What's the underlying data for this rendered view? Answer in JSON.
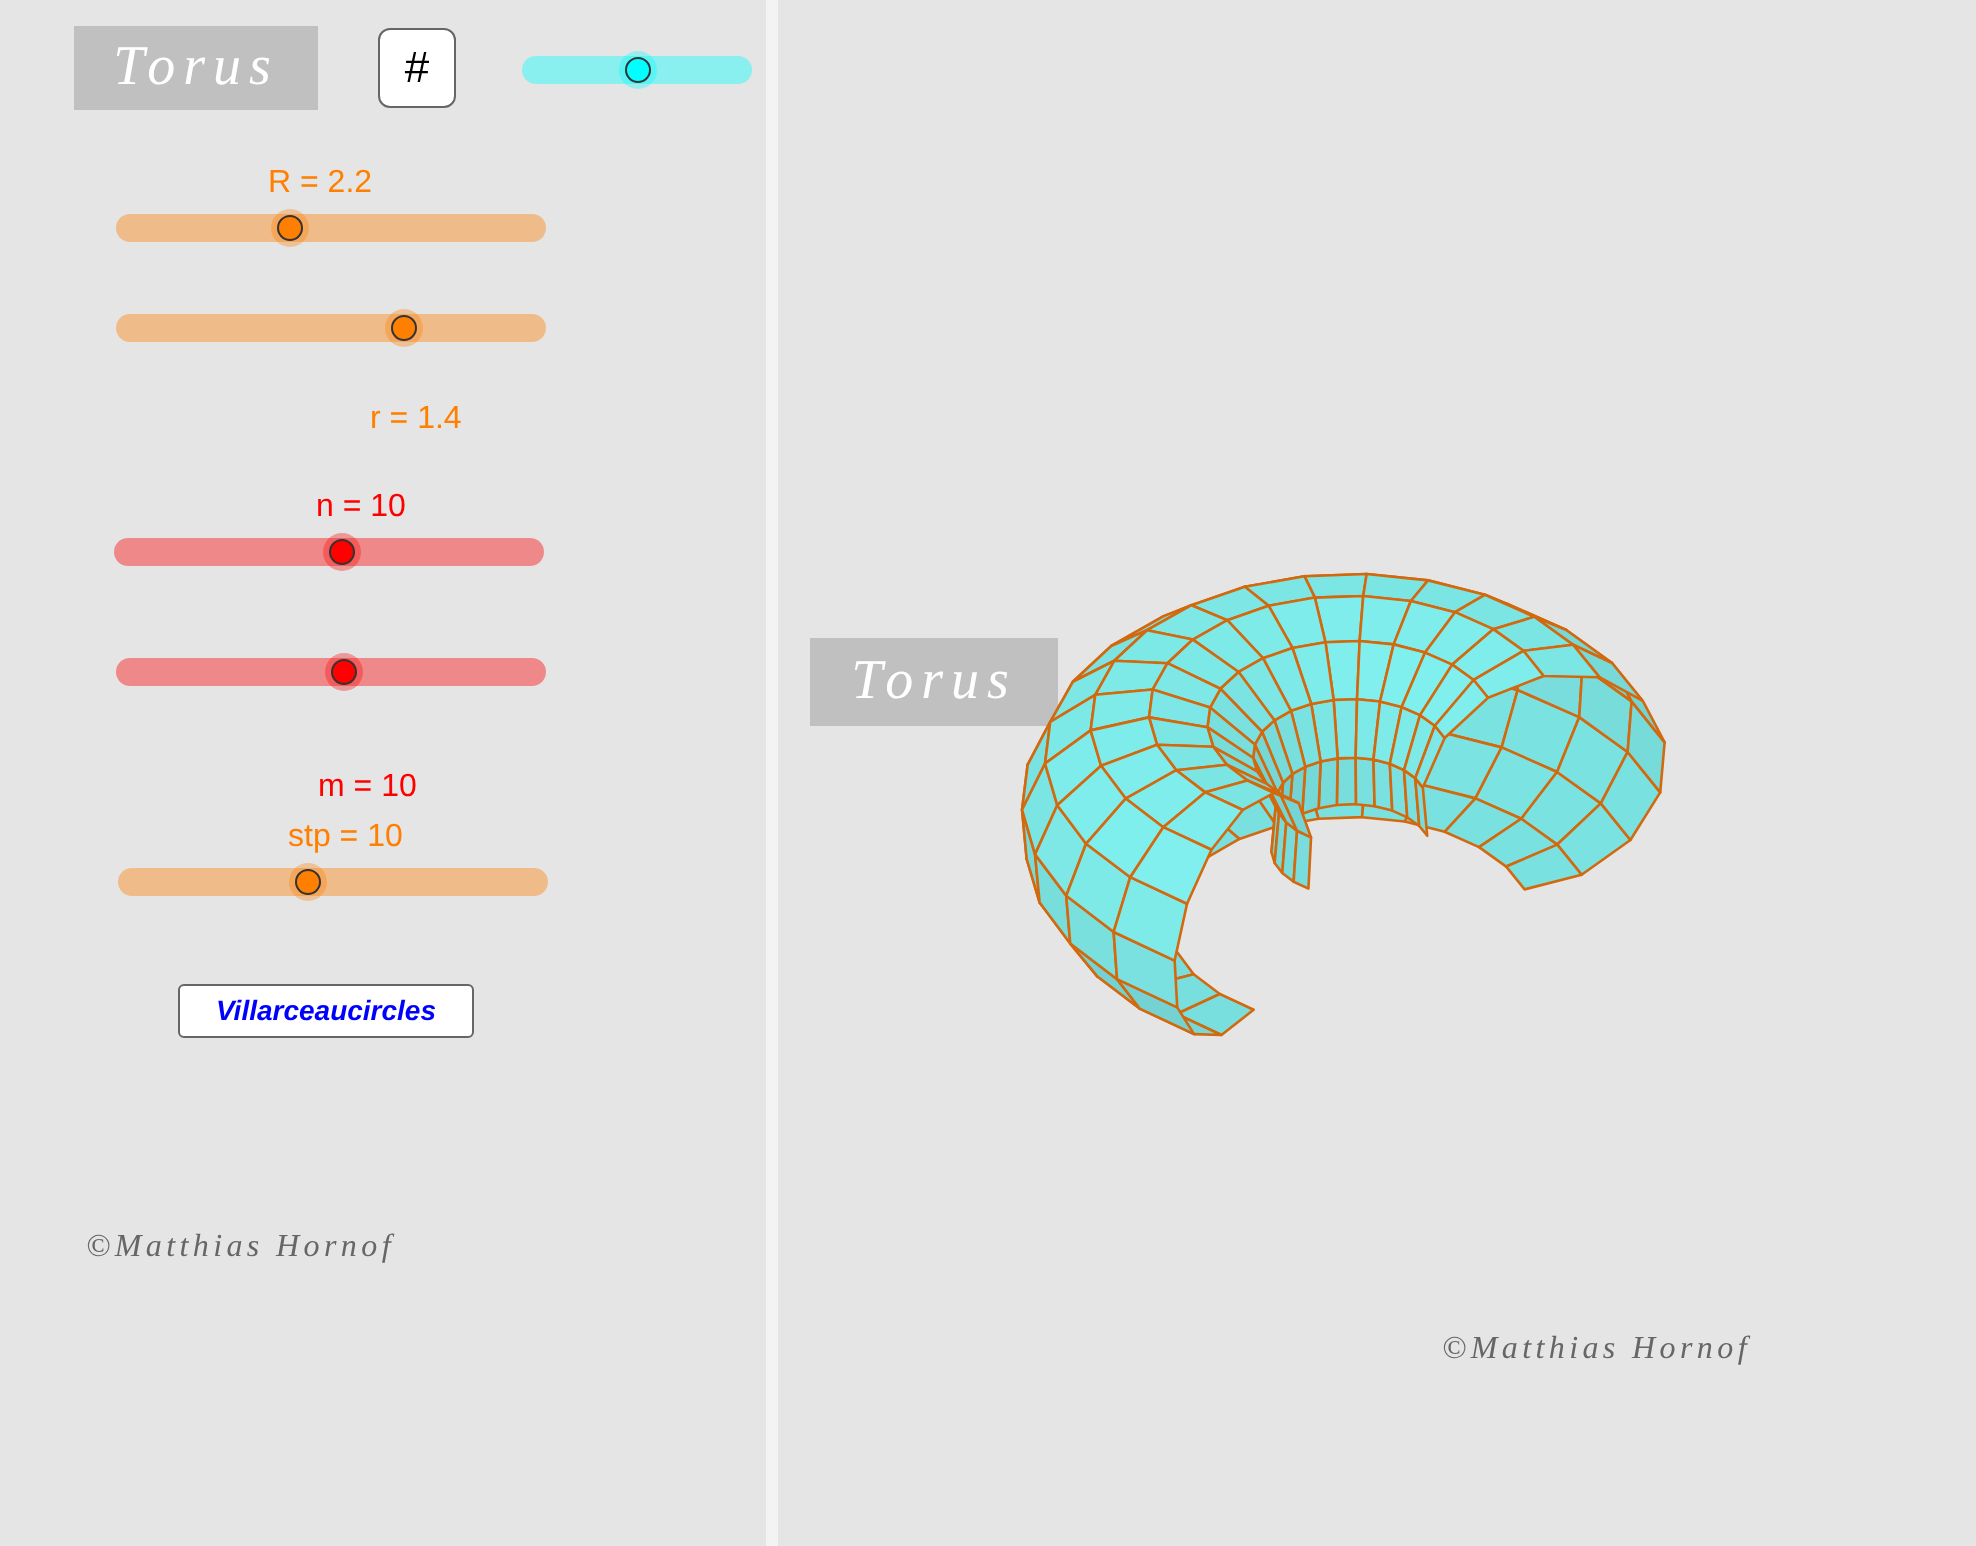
{
  "graphics_view": {
    "title": "Torus",
    "grid_button": "#",
    "sliders": [
      {
        "color": "#00ffff",
        "level": 0.5
      },
      {
        "label": "R = 2.2",
        "color": "#ff7f00",
        "level": 0.4
      },
      {
        "label": "r = 1.4",
        "color": "#ff7f00",
        "level": 0.68
      },
      {
        "label": "n = 10",
        "color": "#ff0000",
        "level": 0.53
      },
      {
        "label": "m = 10",
        "color": "#ff0000",
        "level": 0.53
      },
      {
        "label": "stp = 10",
        "color": "#ff7f00",
        "level": 0.44
      }
    ],
    "button": "Villarceaucircles",
    "credit": "©Matthias Hornof"
  },
  "view_3d": {
    "title": "Torus",
    "credit": "©Matthias Hornof"
  }
}
